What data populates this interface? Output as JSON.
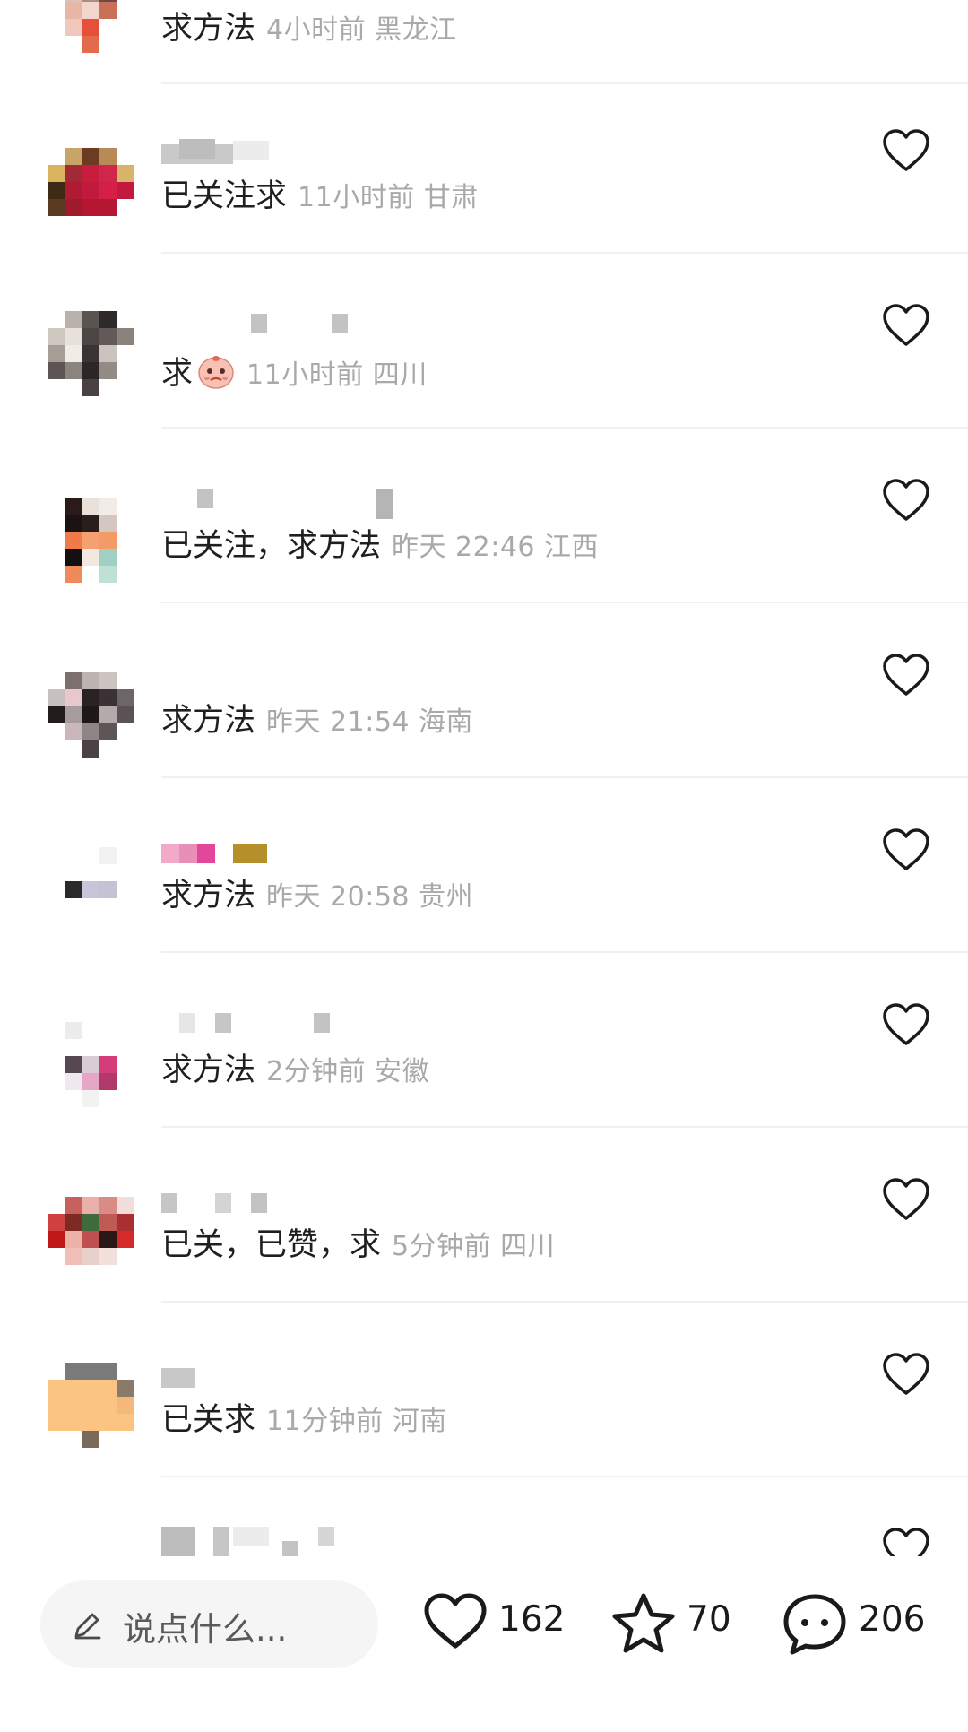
{
  "comments": [
    {
      "text": "求方法",
      "meta": "4小时前 黑龙江",
      "has_like": false
    },
    {
      "text": "已关注求",
      "meta": "11小时前 甘肃",
      "has_like": true
    },
    {
      "text": "求",
      "meta": "11小时前 四川",
      "has_like": true,
      "emoji": "pleading-face-emoji"
    },
    {
      "text": "已关注，求方法",
      "meta": "昨天 22:46 江西",
      "has_like": true
    },
    {
      "text": "求方法",
      "meta": "昨天 21:54 海南",
      "has_like": true
    },
    {
      "text": "求方法",
      "meta": "昨天 20:58 贵州",
      "has_like": true
    },
    {
      "text": "求方法",
      "meta": "2分钟前 安徽",
      "has_like": true
    },
    {
      "text": "已关，已赞，求",
      "meta": "5分钟前 四川",
      "has_like": true
    },
    {
      "text": "已关求",
      "meta": "11分钟前 河南",
      "has_like": true
    },
    {
      "text": "",
      "meta": "",
      "has_like": true
    }
  ],
  "bottom_bar": {
    "input_placeholder": "说点什么...",
    "likes": "162",
    "favorites": "70",
    "comments": "206"
  },
  "icons": {
    "like": "heart-icon",
    "favorite": "star-icon",
    "comment": "chat-bubble-icon",
    "edit": "pencil-icon"
  },
  "colors": {
    "primary_text": "#1f1f1f",
    "meta_text": "#a9a9a9",
    "divider": "#f0f0f0"
  }
}
